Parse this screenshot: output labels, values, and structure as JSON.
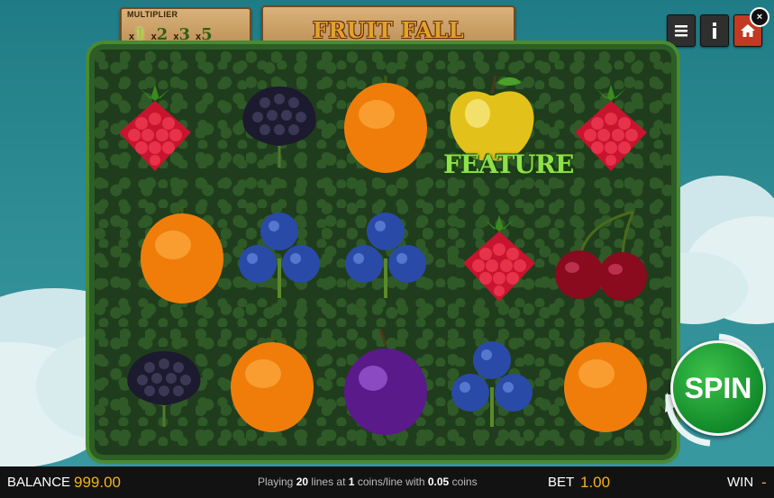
{
  "header": {
    "multiplier_title": "MULTIPLIER",
    "multipliers": [
      {
        "prefix": "x",
        "value": "1"
      },
      {
        "prefix": "x",
        "value": "2"
      },
      {
        "prefix": "x",
        "value": "3"
      },
      {
        "prefix": "x",
        "value": "5"
      }
    ],
    "game_title": "FRUIT FALL FORTUNES"
  },
  "controls": {
    "menu_icon": "hamburger-icon",
    "info_icon": "info-icon",
    "home_icon": "home-icon",
    "close_label": "×",
    "spin_label": "SPIN"
  },
  "reels": [
    [
      "raspberry",
      "orange",
      "blackberry"
    ],
    [
      "blackberry",
      "blueberry",
      "orange"
    ],
    [
      "orange",
      "blueberry",
      "plum"
    ],
    [
      "golden-apple",
      "raspberry",
      "blueberry"
    ],
    [
      "raspberry",
      "cherry",
      "orange"
    ]
  ],
  "feature_label": "FEATURE",
  "status": {
    "balance_label": "BALANCE",
    "balance_value": "999.00",
    "playing_prefix": "Playing",
    "lines": "20",
    "lines_text": "lines at",
    "coins": "1",
    "coins_text": "coins/line with",
    "coin_value": "0.05",
    "coin_suffix": "coins",
    "bet_label": "BET",
    "bet_value": "1.00",
    "win_label": "WIN",
    "win_value": "-"
  },
  "colors": {
    "accent_gold": "#f2b21e",
    "spin_green": "#128a2a",
    "home_red": "#c23a22"
  }
}
